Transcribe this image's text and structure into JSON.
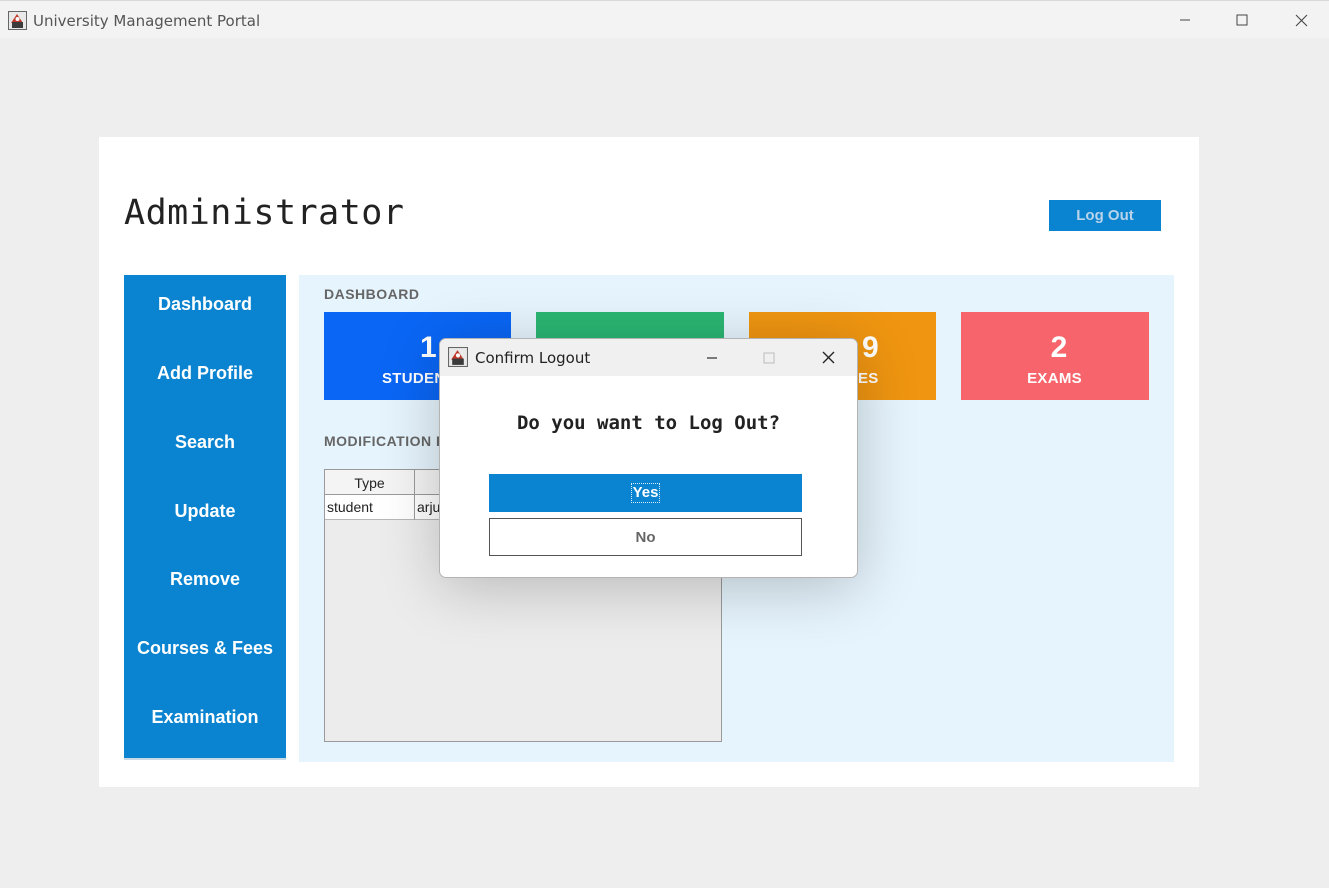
{
  "window": {
    "title": "University Management Portal"
  },
  "header": {
    "role_title": "Administrator",
    "logout_label": "Log Out"
  },
  "sidebar": {
    "items": [
      {
        "label": "Dashboard"
      },
      {
        "label": "Add Profile"
      },
      {
        "label": "Search"
      },
      {
        "label": "Update"
      },
      {
        "label": "Remove"
      },
      {
        "label": "Courses & Fees"
      },
      {
        "label": "Examination"
      }
    ]
  },
  "dashboard": {
    "section_label": "DASHBOARD",
    "stats": [
      {
        "value": "1",
        "label": "STUDEN",
        "color": "#0a66f5"
      },
      {
        "value": "",
        "label": "",
        "color": "#2bb673"
      },
      {
        "value": "9",
        "label": "ES",
        "color": "#ef9511"
      },
      {
        "value": "2",
        "label": "EXAMS",
        "color": "#f7646b"
      }
    ],
    "modification_label": "MODIFICATION R",
    "table": {
      "columns": [
        "Type",
        ""
      ],
      "rows": [
        [
          "student",
          "arju"
        ]
      ]
    }
  },
  "dialog": {
    "title": "Confirm Logout",
    "message": "Do you want to Log Out?",
    "yes_label": "Yes",
    "no_label": "No"
  },
  "colors": {
    "accent": "#0a84d0",
    "panel_bg": "#e6f4fd"
  }
}
